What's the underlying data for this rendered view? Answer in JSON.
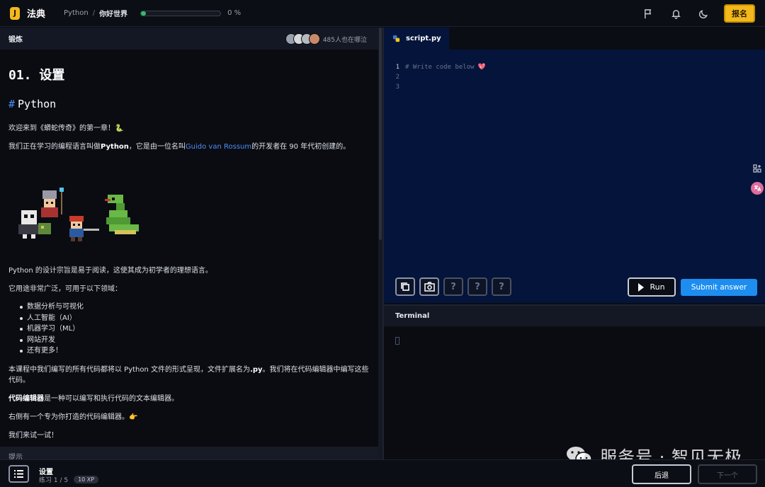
{
  "header": {
    "logo_letter": "J",
    "brand": "法典",
    "breadcrumb_course": "Python",
    "breadcrumb_separator": "/",
    "breadcrumb_current": "你好世界",
    "progress_percent_label": "0 %",
    "progress_fraction": 0.06,
    "signup_label": "报名"
  },
  "icons": {
    "flag": "flag-icon",
    "bell": "bell-icon",
    "moon": "moon-icon"
  },
  "left_panel": {
    "header_title": "锻炼",
    "peers_text": "485人也在哪泣",
    "lesson_heading": "01. 设置",
    "section_hash": "#",
    "section_heading": "Python",
    "intro_text": "欢迎来到《蟒蛇传奇》的第一章！🐍",
    "p2_a": "我们正在学习的编程语言叫做",
    "p2_bold": "Python",
    "p2_b": "，它是由一位名叫",
    "p2_link": "Guido van Rossum",
    "p2_c": "的开发者在 90 年代初创建的。",
    "p3": "Python 的设计宗旨是易于阅读，这使其成为初学者的理想语言。",
    "p4": "它用途非常广泛，可用于以下领域：",
    "uses": [
      "数据分析与可视化",
      "人工智能（AI）",
      "机器学习（ML）",
      "网站开发",
      "还有更多！"
    ],
    "p5_a": "本课程中我们编写的所有代码都将以 Python 文件的形式呈现，文件扩展名为",
    "p5_bold": ".py",
    "p5_b": "。我们将在代码编辑器中编写这些代码。",
    "p6_bold": "代码编辑器",
    "p6_rest": "是一种可以编写和执行代码的文本编辑器。",
    "p7": "右侧有一个专为你打造的代码编辑器。👉",
    "p8": "我们来试一试！",
    "hint_label": "提示"
  },
  "editor": {
    "tab_name": "script.py",
    "line_numbers": [
      "1",
      "2",
      "3"
    ],
    "line1_comment": "# Write code below",
    "line1_emoji": "💖",
    "tool_help_glyph": "?",
    "run_label": "Run",
    "submit_label": "Submit answer"
  },
  "terminal": {
    "title": "Terminal"
  },
  "watermark": {
    "text": "服务号 · 智见无极"
  },
  "footer": {
    "lesson_title": "设置",
    "progress_text": "练习 1 / 5",
    "xp_badge": "10 XP",
    "back_label": "后退",
    "next_label": "下一个"
  },
  "colors": {
    "accent_yellow": "#f3b91c",
    "progress_green": "#2fc06a",
    "link_blue": "#4e8ef7",
    "submit_blue": "#1d8ef0",
    "editor_bg": "#04143a"
  }
}
